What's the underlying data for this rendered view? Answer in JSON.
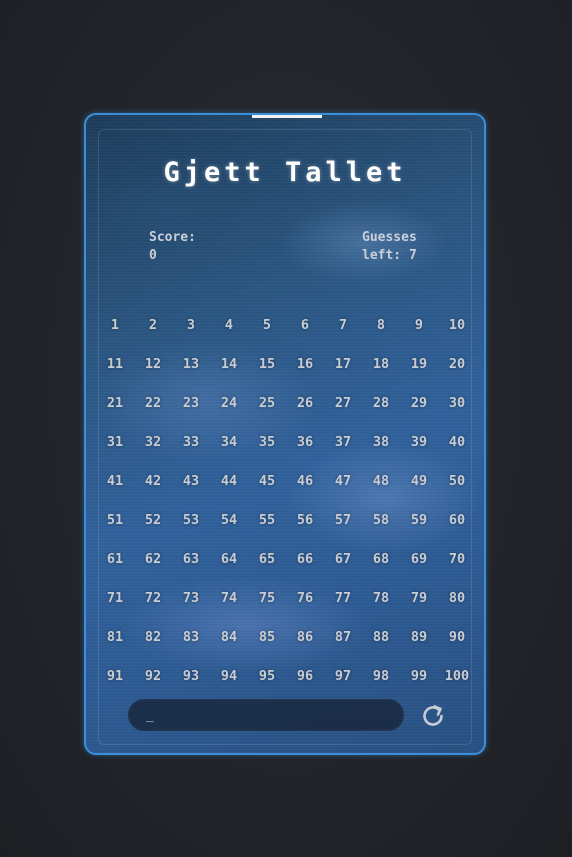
{
  "game": {
    "title": "Gjett Tallet",
    "score_label": "Score:",
    "score_value": "0",
    "guesses_label": "Guesses left: 7",
    "numbers": [
      "1",
      "2",
      "3",
      "4",
      "5",
      "6",
      "7",
      "8",
      "9",
      "10",
      "11",
      "12",
      "13",
      "14",
      "15",
      "16",
      "17",
      "18",
      "19",
      "20",
      "21",
      "22",
      "23",
      "24",
      "25",
      "26",
      "27",
      "28",
      "29",
      "30",
      "31",
      "32",
      "33",
      "34",
      "35",
      "36",
      "37",
      "38",
      "39",
      "40",
      "41",
      "42",
      "43",
      "44",
      "45",
      "46",
      "47",
      "48",
      "49",
      "50",
      "51",
      "52",
      "53",
      "54",
      "55",
      "56",
      "57",
      "58",
      "59",
      "60",
      "61",
      "62",
      "63",
      "64",
      "65",
      "66",
      "67",
      "68",
      "69",
      "70",
      "71",
      "72",
      "73",
      "74",
      "75",
      "76",
      "77",
      "78",
      "79",
      "80",
      "81",
      "82",
      "83",
      "84",
      "85",
      "86",
      "87",
      "88",
      "89",
      "90",
      "91",
      "92",
      "93",
      "94",
      "95",
      "96",
      "97",
      "98",
      "99",
      "100"
    ],
    "input_value": "_",
    "restart_icon": "restart-icon"
  },
  "colors": {
    "accent": "#3a8fd9",
    "text": "#c8ccd3",
    "title": "#ffffff"
  }
}
